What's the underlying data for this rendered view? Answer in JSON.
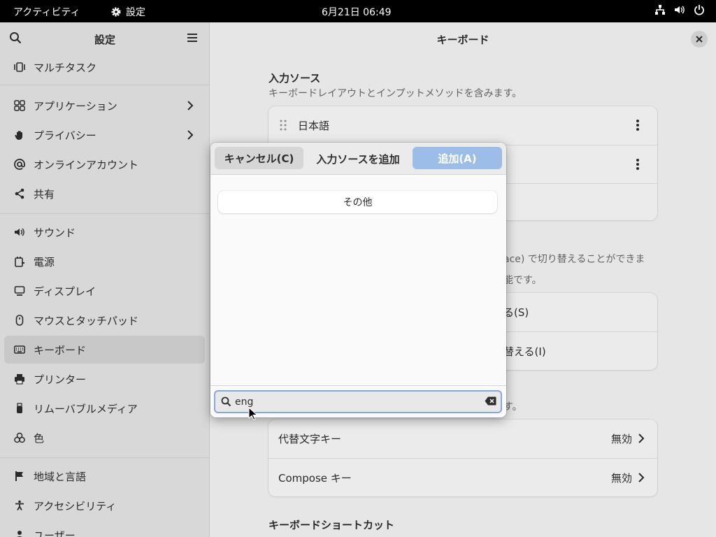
{
  "topbar": {
    "activities": "アクティビティ",
    "app_name": "設定",
    "clock": "6月21日 06:49",
    "icons": [
      "network-icon",
      "volume-icon",
      "power-icon"
    ]
  },
  "sidebar": {
    "title": "設定",
    "items": [
      {
        "label": "マルチタスク",
        "icon": "multitasking-icon"
      },
      {
        "label": "アプリケーション",
        "icon": "apps-icon",
        "chevron": true
      },
      {
        "label": "プライバシー",
        "icon": "hand-icon",
        "chevron": true
      },
      {
        "label": "オンラインアカウント",
        "icon": "at-icon"
      },
      {
        "label": "共有",
        "icon": "share-icon"
      },
      {
        "label": "サウンド",
        "icon": "sound-icon"
      },
      {
        "label": "電源",
        "icon": "power-plug-icon"
      },
      {
        "label": "ディスプレイ",
        "icon": "display-icon"
      },
      {
        "label": "マウスとタッチパッド",
        "icon": "mouse-icon"
      },
      {
        "label": "キーボード",
        "icon": "keyboard-icon",
        "selected": true
      },
      {
        "label": "プリンター",
        "icon": "printer-icon"
      },
      {
        "label": "リムーバブルメディア",
        "icon": "usb-icon"
      },
      {
        "label": "色",
        "icon": "color-icon"
      },
      {
        "label": "地域と言語",
        "icon": "flag-icon"
      },
      {
        "label": "アクセシビリティ",
        "icon": "accessibility-icon"
      },
      {
        "label": "ユーザー",
        "icon": "user-icon"
      }
    ]
  },
  "main": {
    "title": "キーボード",
    "input_sources": {
      "heading": "入力ソース",
      "description": "キーボードレイアウトとインプットメソッドを含みます。",
      "items": [
        "日本語"
      ]
    },
    "switch_partial_1": "ace) で切り替えることができま",
    "switch_partial_2": "能です。",
    "switch_row1_partial": "る(S)",
    "switch_row2_partial": "替える(I)",
    "special_desc_partial": "す。",
    "special_rows": [
      {
        "label": "代替文字キー",
        "value": "無効"
      },
      {
        "label": "Compose キー",
        "value": "無効"
      }
    ],
    "shortcuts_heading": "キーボードショートカット"
  },
  "dialog": {
    "cancel_label": "キャンセル(C)",
    "title": "入力ソースを追加",
    "add_label": "追加(A)",
    "other_label": "その他",
    "search_value": "eng"
  }
}
